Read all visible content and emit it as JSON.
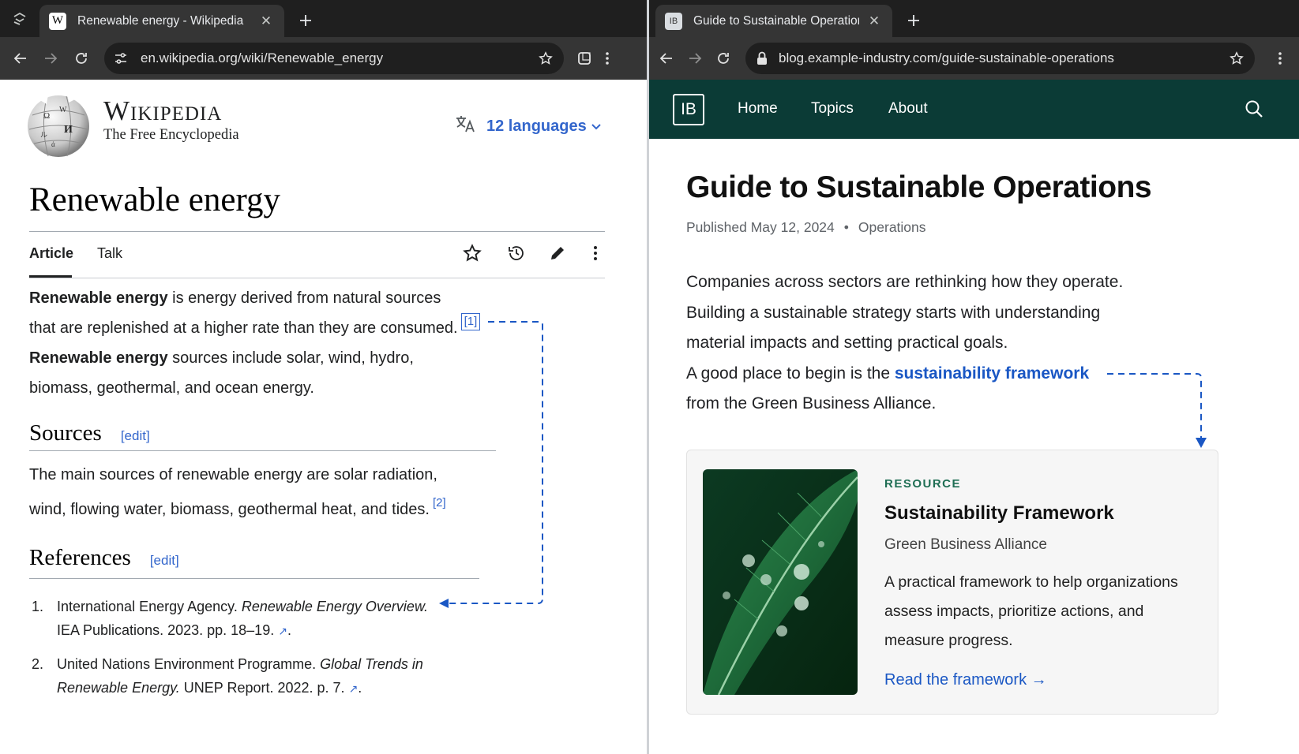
{
  "left_window": {
    "tab": {
      "title": "Renewable energy - Wikipedia",
      "favicon_letter": "W"
    },
    "url": "en.wikipedia.org/wiki/Renewable_energy",
    "wikipedia": {
      "wordmark": "Wikipedia",
      "tagline": "The Free Encyclopedia",
      "languages_label": "12 languages",
      "title": "Renewable energy",
      "tabs": [
        "Article",
        "Talk"
      ],
      "intro": {
        "p1_bold": "Renewable energy",
        "p1_rest_line1": " is energy derived from natural sources",
        "p1_line2": "that are replenished at a higher rate than they are consumed.",
        "p1_ref": "[1]",
        "p2_bold": "Renewable energy",
        "p2_rest_line1": " sources include solar, wind, hydro,",
        "p2_line2": "biomass, geothermal, and ocean energy."
      },
      "sources": {
        "heading": "Sources",
        "edit": "[edit]",
        "line1": "The main sources of renewable energy are solar radiation,",
        "line2": "wind, flowing water, biomass, geothermal heat, and tides.",
        "ref": "[2]"
      },
      "references": {
        "heading": "References",
        "edit": "[edit]",
        "items": [
          {
            "num": "1.",
            "a": "International Energy Agency. ",
            "title": "Renewable Energy Overview.",
            "b": "IEA Publications. 2023. pp. 18–19. ",
            "end": "."
          },
          {
            "num": "2.",
            "a": "United Nations Environment Programme. ",
            "title_line1": "Global Trends in",
            "title_line2": "Renewable Energy.",
            "b": " UNEP Report. 2022. p. 7. ",
            "end": "."
          }
        ]
      }
    }
  },
  "right_window": {
    "tab": {
      "title": "Guide to Sustainable Operations",
      "favicon_letter": "IB"
    },
    "url": "blog.example-industry.com/guide-sustainable-operations",
    "blog": {
      "logo": "IB",
      "nav": [
        "Home",
        "Topics",
        "About"
      ],
      "title": "Guide to Sustainable Operations",
      "published": "Published May 12, 2024",
      "category": "Operations",
      "para_lines": [
        "Companies across sectors are rethinking how they operate.",
        "Building a sustainable strategy starts with understanding",
        "material impacts and setting practical goals."
      ],
      "link_prefix": "A good place to begin is the ",
      "link_text": "sustainability framework",
      "link_suffix": "from the Green Business Alliance.",
      "card": {
        "kicker": "RESOURCE",
        "title": "Sustainability Framework",
        "publisher": "Green Business Alliance",
        "desc_lines": [
          "A practical framework to help organizations",
          "assess impacts, prioritize actions, and",
          "measure progress."
        ],
        "cta": "Read the framework →"
      }
    }
  },
  "colors": {
    "link_blue": "#3366cc",
    "blog_header": "#0b3b36",
    "chrome_dark": "#1f1f1f",
    "annotation_blue": "#1a57c4"
  }
}
